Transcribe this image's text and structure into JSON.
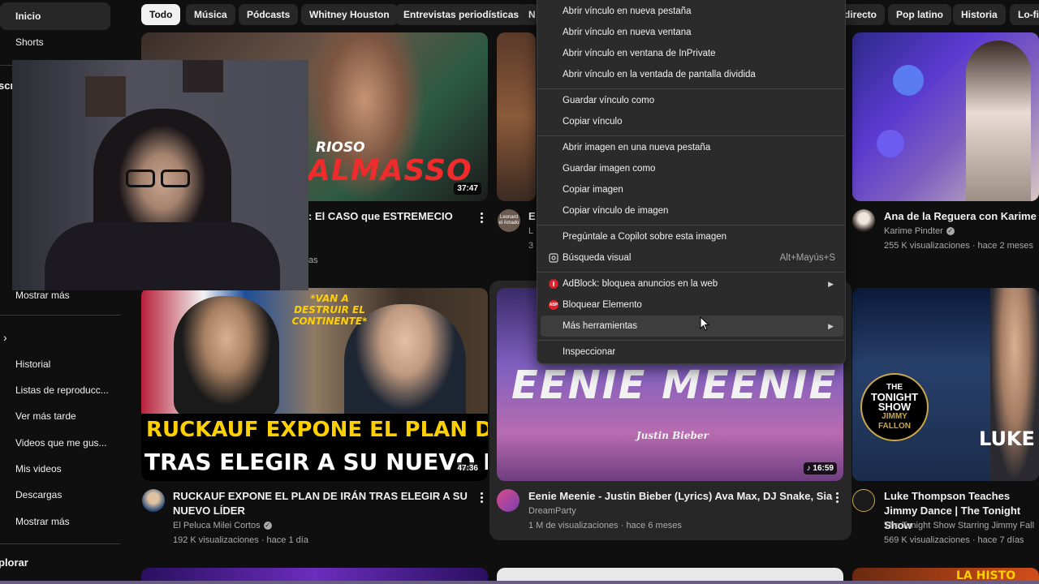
{
  "sidebar": {
    "items": [
      {
        "label": "Inicio"
      },
      {
        "label": "Shorts"
      }
    ],
    "section_partial": "scri",
    "show_more_1": "Mostrar más",
    "you_items": [
      {
        "label": "Historial"
      },
      {
        "label": "Listas de reproducc..."
      },
      {
        "label": "Ver más tarde"
      },
      {
        "label": "Videos que me gus..."
      },
      {
        "label": "Mis videos"
      },
      {
        "label": "Descargas"
      }
    ],
    "show_more_2": "Mostrar más",
    "explore_partial": "plorar"
  },
  "chips": [
    {
      "label": "Todo"
    },
    {
      "label": "Música"
    },
    {
      "label": "Pódcasts"
    },
    {
      "label": "Whitney Houston"
    },
    {
      "label": "Entrevistas periodísticas"
    },
    {
      "label": "N"
    },
    {
      "label": "directo"
    },
    {
      "label": "Pop latino"
    },
    {
      "label": "Historia"
    },
    {
      "label": "Lo-fi"
    }
  ],
  "videos": [
    {
      "title": ": El CASO que ESTREMECIO",
      "duration": "37:47",
      "thumb_text": "RIOSO",
      "thumb_text2": "ALMASSO",
      "meta_partial": "as"
    },
    {
      "title_partial": "E",
      "channel_partial": "L",
      "meta_partial": "3",
      "thumb_badge": "Leonard el Amado"
    },
    {
      "title": "Ana de la Reguera con Karime Pi",
      "channel": "Karime Pindter",
      "meta": "255 K visualizaciones · hace 2 meses"
    },
    {
      "title": "RUCKAUF EXPONE EL PLAN DE IRÁN TRAS ELEGIR A SU NUEVO LÍDER",
      "channel": "El Peluca Milei Cortos",
      "meta": "192 K visualizaciones · hace 1 día",
      "duration": "47:36",
      "thumb_line1": "RUCKAUF EXPONE EL PLAN DE IRÁN",
      "thumb_line2": "TRAS ELEGIR A SU NUEVO LÍDER",
      "thumb_tag": "*VAN A DESTRUIR EL CONTINENTE*"
    },
    {
      "title": "Eenie Meenie - Justin Bieber (Lyrics) Ava Max, DJ Snake, Sia",
      "channel": "DreamParty",
      "meta": "1 M de visualizaciones · hace 6 meses",
      "duration": "16:59",
      "thumb_title": "EENIE MEENIE",
      "thumb_sub": "Justin Bieber"
    },
    {
      "title": "Luke Thompson Teaches Jimmy Dance | The Tonight Show",
      "channel": "The Tonight Show Starring Jimmy Fall",
      "meta": "569 K visualizaciones · hace 7 días",
      "thumb_logo1": "THE",
      "thumb_logo2": "TONIGHT",
      "thumb_logo3": "SHOW",
      "thumb_logo4": "JIMMY",
      "thumb_logo5": "FALLON",
      "thumb_name": "LUKE T"
    }
  ],
  "bottom_partial": "LA HISTO",
  "context_menu": {
    "items": [
      {
        "label": "Abrir vínculo en nueva pestaña"
      },
      {
        "label": "Abrir vínculo en nueva ventana"
      },
      {
        "label": "Abrir vínculo en ventana de InPrivate"
      },
      {
        "label": "Abrir vínculo en la ventada de pantalla dividida"
      },
      {
        "label": "Guardar vínculo como"
      },
      {
        "label": "Copiar vínculo"
      },
      {
        "label": "Abrir imagen en una nueva pestaña"
      },
      {
        "label": "Guardar imagen como"
      },
      {
        "label": "Copiar imagen"
      },
      {
        "label": "Copiar vínculo de imagen"
      },
      {
        "label": "Pregúntale a Copilot sobre esta imagen"
      },
      {
        "label": "Búsqueda visual",
        "shortcut": "Alt+Mayús+S"
      },
      {
        "label": "AdBlock: bloquea anuncios en la web"
      },
      {
        "label": "Bloquear Elemento"
      },
      {
        "label": "Más herramientas"
      },
      {
        "label": "Inspeccionar"
      }
    ],
    "abp_icon_text": "ABP"
  },
  "colors": {
    "background": "#0f0f0f",
    "chip": "#272727",
    "menu": "#2b2b2b",
    "adblock_red": "#e4202a"
  }
}
